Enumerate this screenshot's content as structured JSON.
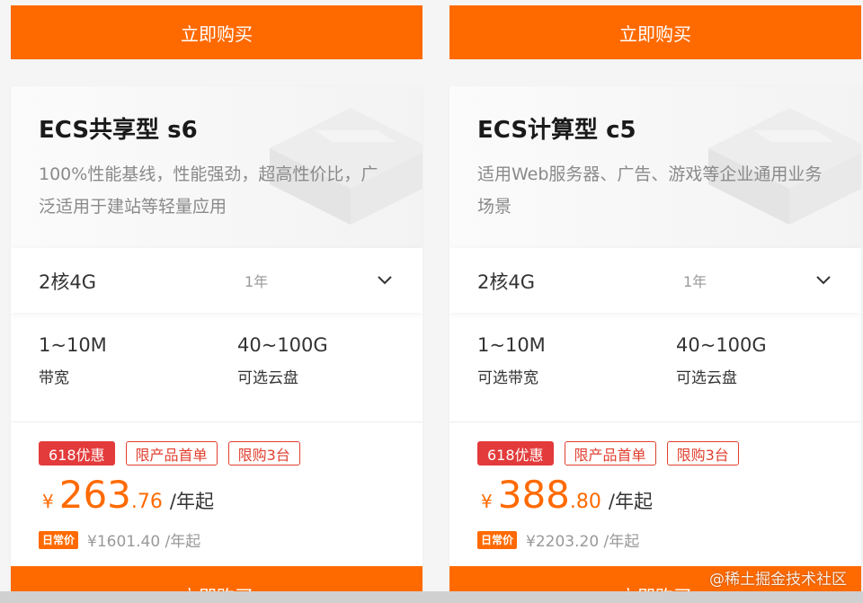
{
  "cards": [
    {
      "buy_label": "立即购买",
      "title": "ECS共享型 s6",
      "description": "100%性能基线，性能强劲，超高性价比，广泛适用于建站等轻量应用",
      "config": {
        "spec": "2核4G",
        "term": "1年"
      },
      "specs": [
        {
          "value": "1~10M",
          "label": "带宽"
        },
        {
          "value": "40~100G",
          "label": "可选云盘"
        }
      ],
      "tags": [
        "618优惠",
        "限产品首单",
        "限购3台"
      ],
      "price": {
        "currency": "¥",
        "integer": "263",
        "decimal": ".76",
        "unit": "/年起"
      },
      "daily": {
        "badge": "日常价",
        "original": "¥1601.40 /年起"
      },
      "buy_bottom_label": "立即购买"
    },
    {
      "buy_label": "立即购买",
      "title": "ECS计算型 c5",
      "description": "适用Web服务器、广告、游戏等企业通用业务场景",
      "config": {
        "spec": "2核4G",
        "term": "1年"
      },
      "specs": [
        {
          "value": "1~10M",
          "label": "可选带宽"
        },
        {
          "value": "40~100G",
          "label": "可选云盘"
        }
      ],
      "tags": [
        "618优惠",
        "限产品首单",
        "限购3台"
      ],
      "price": {
        "currency": "¥",
        "integer": "388",
        "decimal": ".80",
        "unit": "/年起"
      },
      "daily": {
        "badge": "日常价",
        "original": "¥2203.20 /年起"
      },
      "buy_bottom_label": "立即购买"
    }
  ],
  "watermark": "@稀土掘金技术社区",
  "colors": {
    "accent": "#ff6a00",
    "tag_red": "#e33b3b"
  },
  "icons": {
    "dropdown": "chevron-down-icon"
  }
}
